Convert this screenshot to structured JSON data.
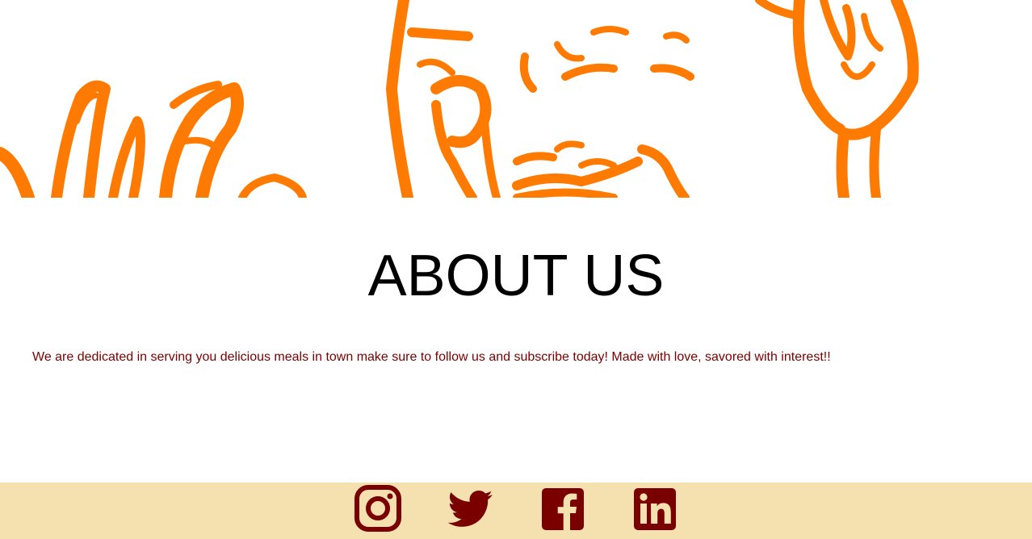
{
  "about": {
    "heading": "ABOUT US",
    "text": "We are dedicated in serving you delicious meals in town make sure to follow us and subscribe today! Made with love, savored with interest!!"
  },
  "footer": {
    "social_icons": [
      "instagram-icon",
      "twitter-icon",
      "facebook-icon",
      "linkedin-icon"
    ]
  },
  "colors": {
    "hero_art": "#ff7a00",
    "text_accent": "#7a0000",
    "footer_bg": "#f5e0b0",
    "icon": "#7a0000"
  }
}
